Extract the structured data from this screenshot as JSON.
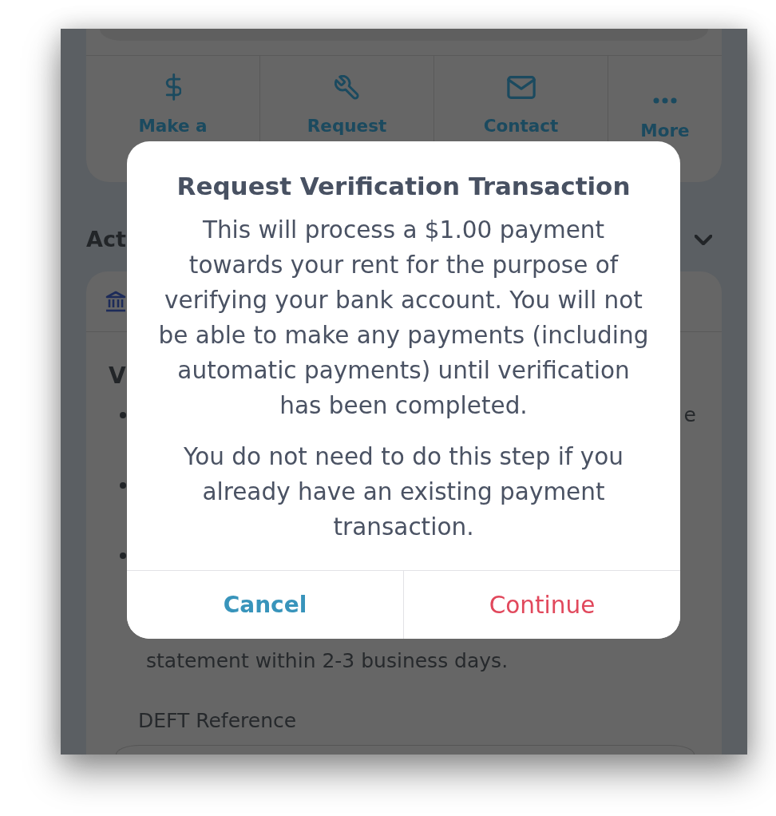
{
  "action_bar": {
    "actions": [
      {
        "label": "Make a"
      },
      {
        "label": "Request"
      },
      {
        "label": "Contact"
      },
      {
        "label": "More"
      }
    ]
  },
  "section": {
    "title": "Act"
  },
  "verification_card": {
    "heading": "V",
    "bullets": [
      {
        "kind": "dot",
        "tail": "e"
      },
      {
        "kind": "dot"
      },
      {
        "kind": "dot"
      }
    ],
    "last_line": "statement within 2-3 business days.",
    "field_label": "DEFT Reference"
  },
  "dialog": {
    "title": "Request Verification Transaction",
    "paragraphs": [
      "This will process a $1.00 payment towards your rent for the purpose of verifying your bank account. You will not be able to make any payments (including automatic payments) until verification has been completed.",
      "You do not need to do this step if you already have an existing payment transaction."
    ],
    "buttons": [
      {
        "label": "Cancel",
        "kind": "cancel"
      },
      {
        "label": "Continue",
        "kind": "confirm"
      }
    ]
  }
}
